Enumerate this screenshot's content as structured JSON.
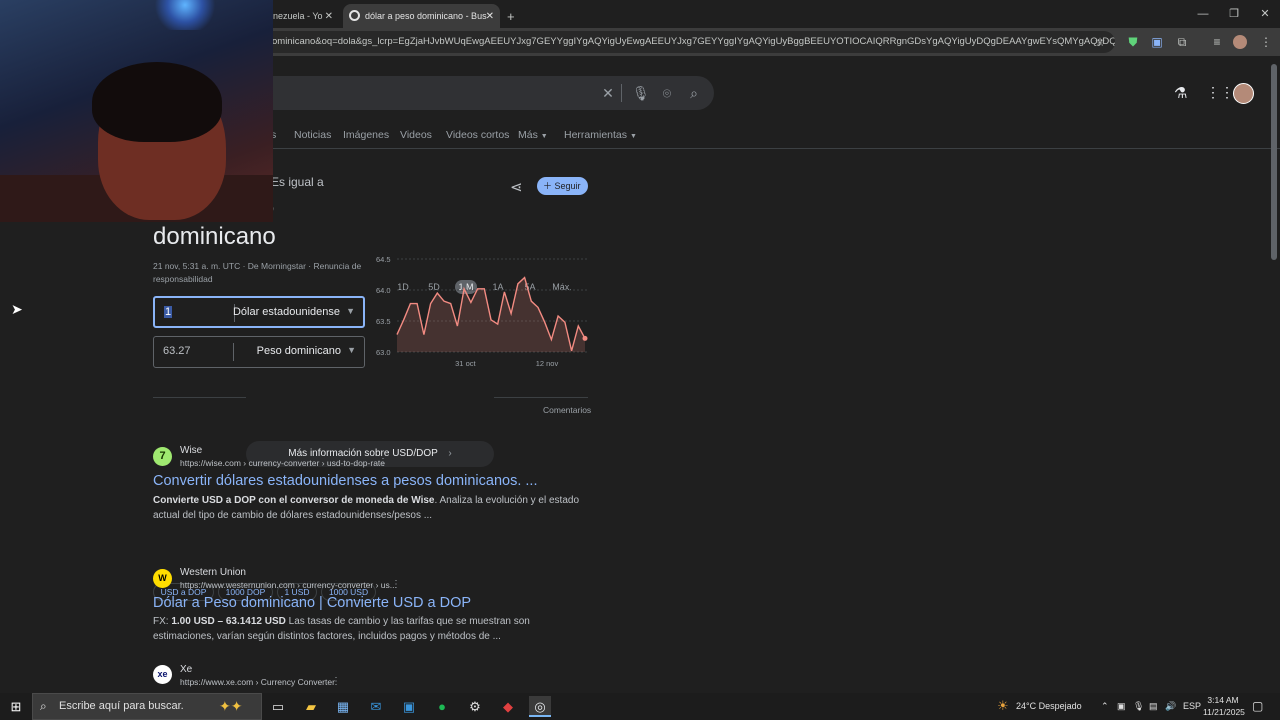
{
  "browser": {
    "tabs": [
      {
        "label": "nezuela - Yo",
        "active": false
      },
      {
        "label": "dólar a peso dominicano - Bus",
        "active": true
      }
    ],
    "new_tab": "+",
    "url": "ominicano&oq=dola&gs_lcrp=EgZjaHJvbWUqEwgAEEUYJxg7GEYYggIYgAQYigUyEwgAEEUYJxg7GEYYggIYgAQYigUyBggBEEUYOTIOCAIQRRgnGDsYgAQYigUyDQgDEAAYgwEYsQMYgAQyDQgEEAAY..."
  },
  "search": {
    "tabs": [
      "Noticias",
      "Imágenes",
      "Videos",
      "Videos cortos",
      "Más",
      "Herramientas"
    ],
    "tabs_partial": "s"
  },
  "converter": {
    "heading_partial": "Es igual a",
    "heading_line2_partial": "0",
    "title": "dominicano",
    "follow_label": "Seguir",
    "meta": "21 nov, 5:31 a. m. UTC · De Morningstar · Renuncia de responsabilidad",
    "from": {
      "amount": "1",
      "currency": "Dólar estadounidense"
    },
    "to": {
      "amount": "63.27",
      "currency": "Peso dominicano"
    },
    "ranges": [
      "1D",
      "5D",
      "1 M",
      "1A",
      "5A",
      "Máx."
    ],
    "selected_range": "1 M",
    "more_info": "Más información sobre USD/DOP",
    "feedback": "Comentarios"
  },
  "chart_data": {
    "type": "line",
    "x": [
      "21 oct",
      "22 oct",
      "23 oct",
      "24 oct",
      "25 oct",
      "26 oct",
      "27 oct",
      "28 oct",
      "29 oct",
      "30 oct",
      "31 oct",
      "1 nov",
      "2 nov",
      "3 nov",
      "4 nov",
      "5 nov",
      "6 nov",
      "7 nov",
      "8 nov",
      "9 nov",
      "10 nov",
      "11 nov",
      "12 nov",
      "13 nov",
      "14 nov",
      "15 nov",
      "16 nov",
      "17 nov",
      "18 nov",
      "19 nov",
      "20 nov",
      "21 nov"
    ],
    "values": [
      63.28,
      63.52,
      63.78,
      63.78,
      63.28,
      63.78,
      63.95,
      63.82,
      63.78,
      63.42,
      64.02,
      63.8,
      64.02,
      64.02,
      63.52,
      63.45,
      63.97,
      63.62,
      64.1,
      64.2,
      63.82,
      63.72,
      63.48,
      63.2,
      63.58,
      63.48,
      63.02,
      63.42,
      63.22
    ],
    "xticks": [
      "31 oct",
      "12 nov"
    ],
    "yticks": [
      63.0,
      63.5,
      64.0,
      64.5
    ],
    "ylim": [
      63.0,
      64.5
    ],
    "color": "#f28b82"
  },
  "results": [
    {
      "site": "Wise",
      "url": "https://wise.com › currency-converter › usd-to-dop-rate",
      "title": "Convertir dólares estadounidenses a pesos dominicanos. ...",
      "snippet_bold": "Convierte USD a DOP con el conversor de moneda de Wise",
      "snippet_rest": ". Analiza la evolución y el estado actual del tipo de cambio de dólares estadounidenses/pesos ...",
      "chips": [
        "USD a DOP",
        "1000 DOP",
        "1 USD",
        "1000 USD"
      ]
    },
    {
      "site": "Western Union",
      "url": "https://www.westernunion.com › currency-converter › us...",
      "title": "Dólar a Peso dominicano | Convierte USD a DOP",
      "snippet_prefix": "FX: ",
      "snippet_bold": "1.00 USD – 63.1412 USD",
      "snippet_rest": " Las tasas de cambio y las tarifas que se muestran son estimaciones, varían según distintos factores, incluidos pagos y métodos de ..."
    },
    {
      "site": "Xe",
      "url": "https://www.xe.com › Currency Converter"
    }
  ],
  "taskbar": {
    "search_placeholder": "Escribe aquí para buscar.",
    "weather": "24°C  Despejado",
    "lang": "ESP",
    "time": "3:14 AM",
    "date": "11/21/2025"
  }
}
